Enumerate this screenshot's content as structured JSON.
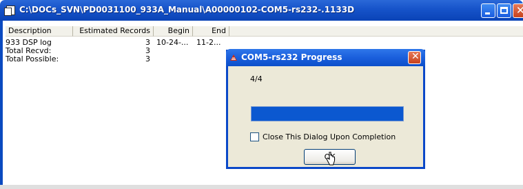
{
  "window": {
    "title": "C:\\DOCs_SVN\\PD0031100_933A_Manual\\A00000102-COM5-rs232-.1133D"
  },
  "list": {
    "columns": [
      "Description",
      "Estimated Records",
      "Begin",
      "End"
    ],
    "rows": [
      {
        "description": "933 DSP log",
        "records": "3",
        "begin": "10-24-...",
        "end": "11-2..."
      },
      {
        "description": "Total Recvd:",
        "records": "3",
        "begin": "",
        "end": ""
      },
      {
        "description": "Total Possible:",
        "records": "3",
        "begin": "",
        "end": ""
      }
    ]
  },
  "dialog": {
    "title": "COM5-rs232 Progress",
    "count": "4/4",
    "progress": 1.0,
    "checkbox_label": "Close This Dialog Upon Completion",
    "ok_label": "OK"
  },
  "colors": {
    "titlebar": "#0a43b6",
    "progress_fill": "#0b58d0"
  }
}
